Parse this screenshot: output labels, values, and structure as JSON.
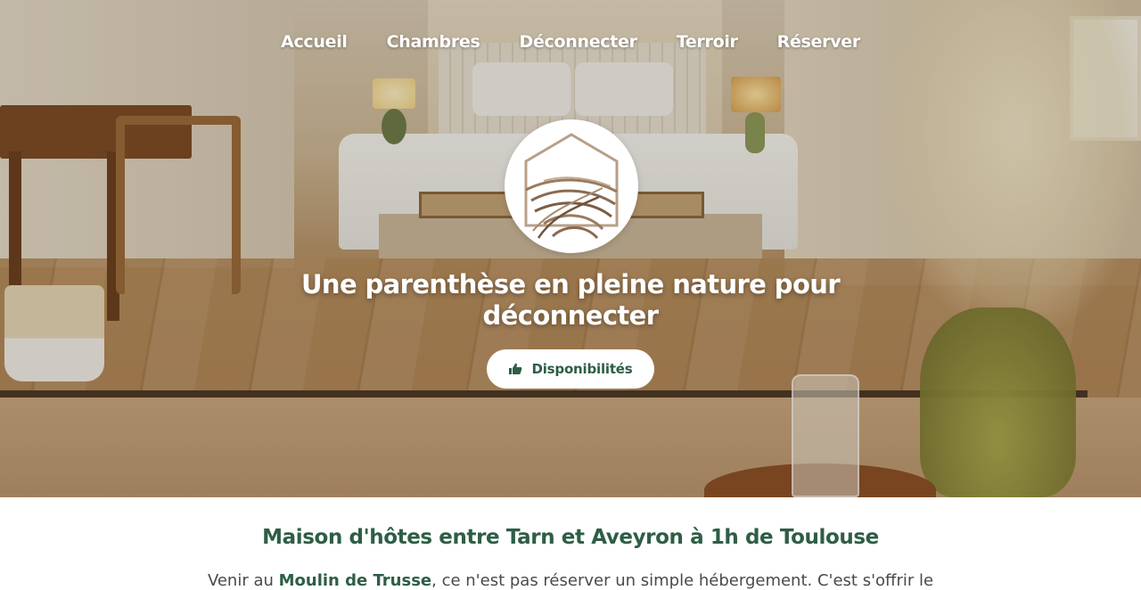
{
  "nav": {
    "items": [
      {
        "label": "Accueil"
      },
      {
        "label": "Chambres"
      },
      {
        "label": "Déconnecter"
      },
      {
        "label": "Terroir"
      },
      {
        "label": "Réserver"
      }
    ]
  },
  "hero": {
    "logo_icon": "house-wheat-logo",
    "headline_line1": "Une parenthèse en pleine nature pour",
    "headline_line2": "déconnecter",
    "cta_icon": "thumbs-up-icon",
    "cta_label": "Disponibilités"
  },
  "intro": {
    "title": "Maison d'hôtes entre Tarn et Aveyron à 1h de Toulouse",
    "text_before": "Venir au ",
    "text_strong": "Moulin de Trusse",
    "text_after": ", ce n'est pas réserver un simple hébergement. C'est s'offrir le"
  },
  "colors": {
    "brand_green": "#2e5e45",
    "white": "#ffffff",
    "logo_brown": "#9a7a5e"
  }
}
